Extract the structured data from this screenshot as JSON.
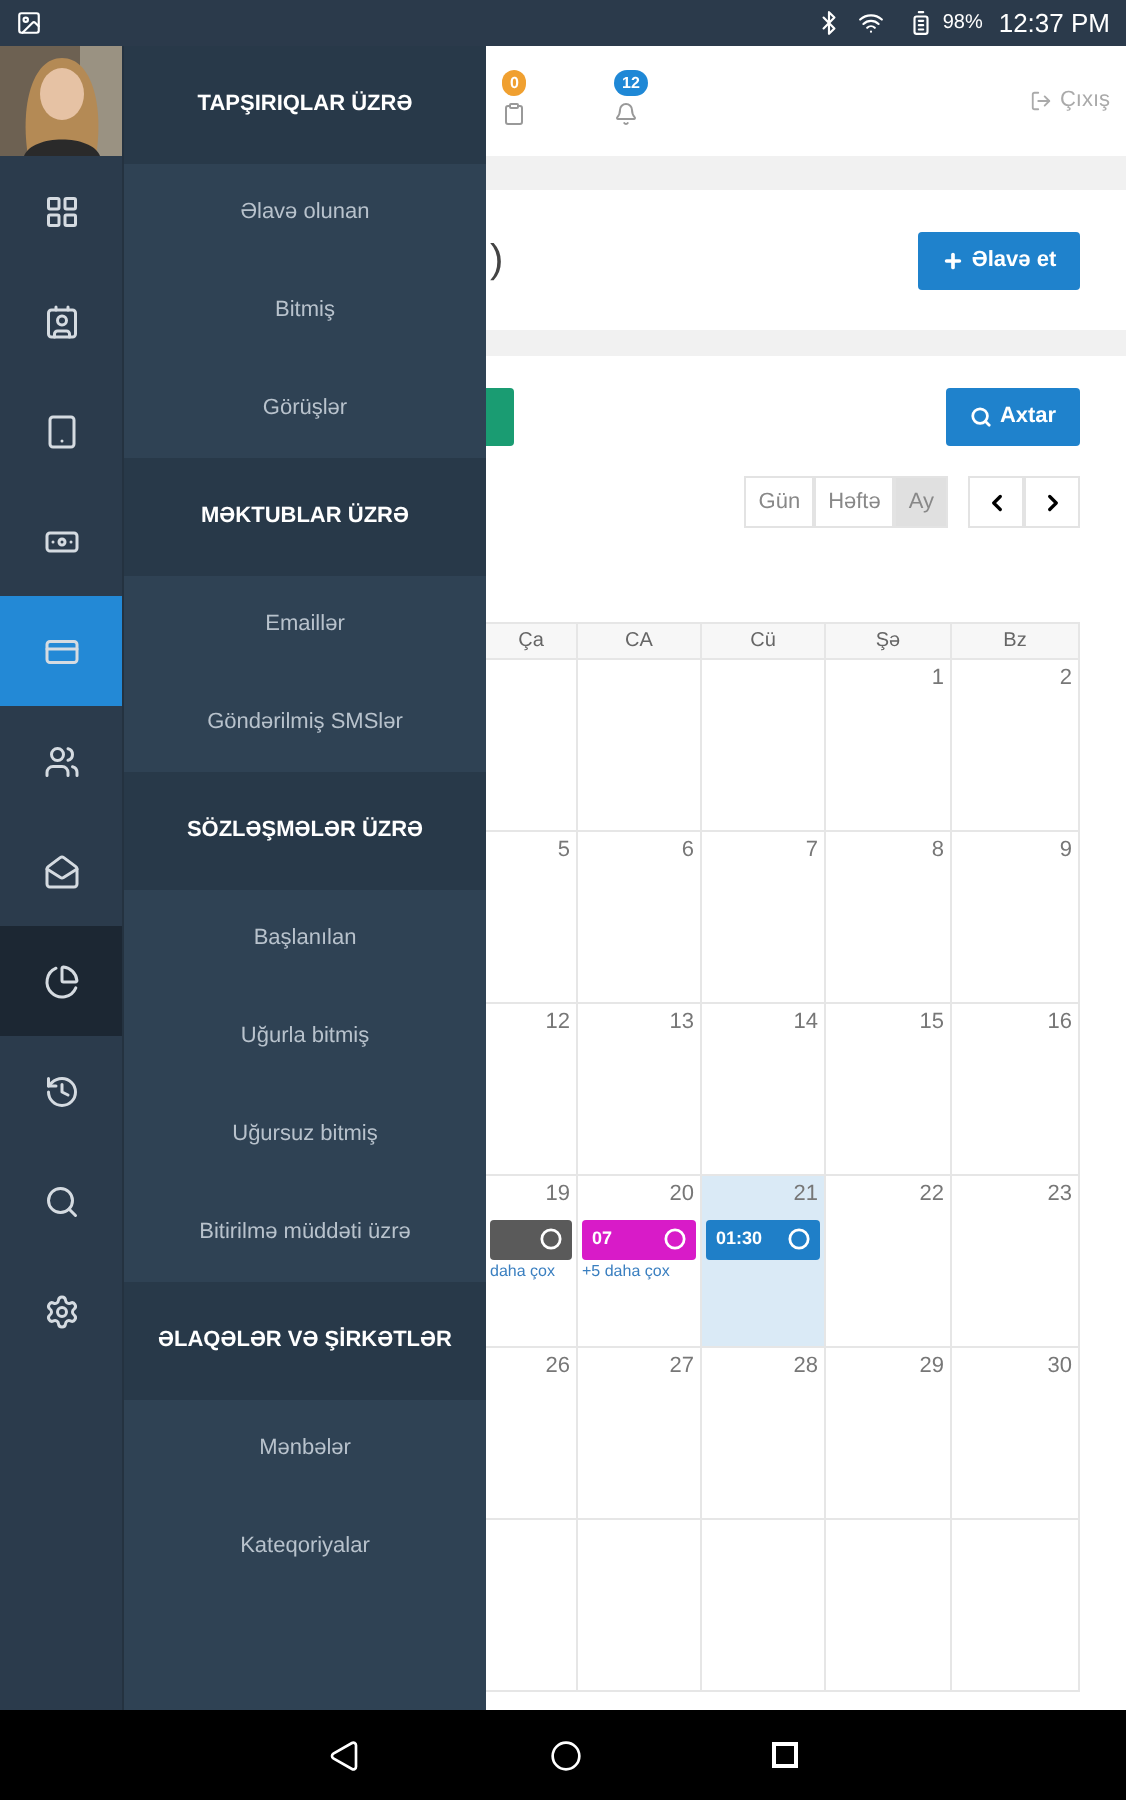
{
  "status_bar": {
    "battery": "98%",
    "time": "12:37 PM"
  },
  "rail": [
    {
      "kind": "grid",
      "selected": false,
      "hovered": false
    },
    {
      "kind": "contact",
      "selected": false,
      "hovered": false
    },
    {
      "kind": "tablet",
      "selected": false,
      "hovered": false
    },
    {
      "kind": "money",
      "selected": false,
      "hovered": false
    },
    {
      "kind": "card",
      "selected": true,
      "hovered": false
    },
    {
      "kind": "people",
      "selected": false,
      "hovered": false
    },
    {
      "kind": "mail",
      "selected": false,
      "hovered": false
    },
    {
      "kind": "pie",
      "selected": false,
      "hovered": true
    },
    {
      "kind": "history",
      "selected": false,
      "hovered": false
    },
    {
      "kind": "search",
      "selected": false,
      "hovered": false
    },
    {
      "kind": "gears",
      "selected": false,
      "hovered": false
    }
  ],
  "menu": [
    {
      "kind": "header",
      "label": "TAPŞIRIQLAR ÜZRƏ"
    },
    {
      "kind": "item",
      "label": "Əlavə olunan"
    },
    {
      "kind": "item",
      "label": "Bitmiş"
    },
    {
      "kind": "item",
      "label": "Görüşlər"
    },
    {
      "kind": "header",
      "label": "MƏKTUBLAR ÜZRƏ"
    },
    {
      "kind": "item",
      "label": "Emaillər"
    },
    {
      "kind": "item",
      "label": "Göndərilmiş SMSlər"
    },
    {
      "kind": "header",
      "label": "SÖZLƏŞMƏLƏR ÜZRƏ"
    },
    {
      "kind": "item",
      "label": "Başlanılan"
    },
    {
      "kind": "item",
      "label": "Uğurla bitmiş"
    },
    {
      "kind": "item",
      "label": "Uğursuz bitmiş"
    },
    {
      "kind": "item",
      "label": "Bitirilmə müddəti üzrə"
    },
    {
      "kind": "header",
      "label": "ƏLAQƏLƏR VƏ ŞİRKƏTLƏR"
    },
    {
      "kind": "item",
      "label": "Mənbələr"
    },
    {
      "kind": "item",
      "label": "Kateqoriyalar"
    }
  ],
  "top_badges": [
    {
      "count": "0",
      "color": "#f0a030"
    },
    {
      "count": "12",
      "color": "#1f88d6"
    }
  ],
  "logout": "Çıxış",
  "title_fragment": ")",
  "add_button": "Əlavə et",
  "search_button": "Axtar",
  "views": [
    {
      "label": "Gün",
      "selected": false
    },
    {
      "label": "Həftə",
      "selected": false
    },
    {
      "label": "Ay",
      "selected": true
    }
  ],
  "calendar": {
    "weekdays": [
      "Ça",
      "CA",
      "Cü",
      "Şə",
      "Bz"
    ],
    "weeks": [
      {
        "kind": "ends_month_start",
        "days": [
          {
            "day": "1"
          },
          {
            "day": "2"
          }
        ]
      },
      {
        "kind": "full",
        "days": [
          {
            "day": "5"
          },
          {
            "day": "6"
          },
          {
            "day": "7"
          },
          {
            "day": "8"
          },
          {
            "day": "9"
          }
        ]
      },
      {
        "kind": "full",
        "days": [
          {
            "day": "12"
          },
          {
            "day": "13"
          },
          {
            "day": "14"
          },
          {
            "day": "15"
          },
          {
            "day": "16"
          }
        ]
      },
      {
        "kind": "full",
        "days": [
          {
            "day": "19",
            "event": {
              "color": "#5a5a5a"
            },
            "more": "daha çox"
          },
          {
            "day": "20",
            "event": {
              "time": "07",
              "color": "#d81bc8"
            },
            "more": "+5 daha çox"
          },
          {
            "day": "21",
            "today": true,
            "event": {
              "time": "01:30",
              "color": "#1f7fc8"
            }
          },
          {
            "day": "22"
          },
          {
            "day": "23"
          }
        ]
      },
      {
        "kind": "full",
        "days": [
          {
            "day": "26"
          },
          {
            "day": "27"
          },
          {
            "day": "28"
          },
          {
            "day": "29"
          },
          {
            "day": "30"
          }
        ]
      }
    ]
  }
}
